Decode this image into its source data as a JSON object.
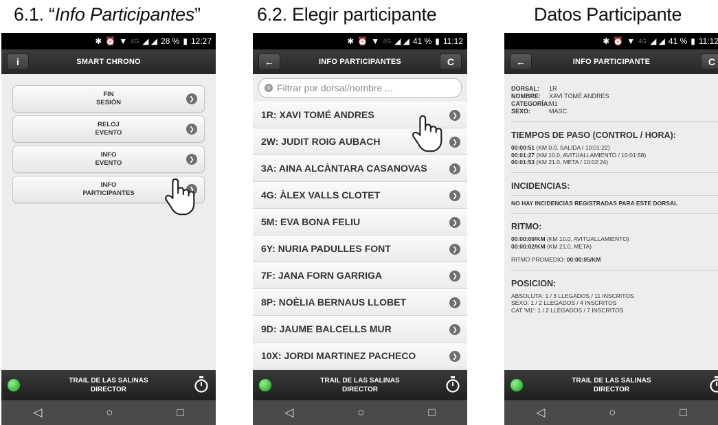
{
  "captions": {
    "c1_prefix": "6.1. “",
    "c1_title": "Info Participantes",
    "c1_suffix": "”",
    "c2": "6.2. Elegir participante",
    "c3": "Datos Participante"
  },
  "phone1": {
    "status": {
      "bt": "✱",
      "alarm": "⏰",
      "wifi": "▼",
      "net": "4G",
      "signal": "◢ ◢",
      "battery_pct": "28 %",
      "battery": "▮",
      "time": "12:27"
    },
    "title": "SMART CHRONO",
    "info_btn": "i",
    "menu": [
      {
        "label": "FIN\nSESIÓN"
      },
      {
        "label": "RELOJ\nEVENTO"
      },
      {
        "label": "INFO\nEVENTO"
      },
      {
        "label": "INFO\nPARTICIPANTES"
      }
    ]
  },
  "phone2": {
    "status": {
      "bt": "✱",
      "alarm": "⏰",
      "wifi": "▼",
      "net": "4G",
      "signal": "◢ ◢",
      "battery_pct": "41 %",
      "battery": "▮",
      "time": "11:12"
    },
    "title": "INFO PARTICIPANTES",
    "back_btn": "←",
    "refresh_btn": "C",
    "filter_placeholder": "Filtrar por dorsal/nombre ...",
    "participants": [
      "1R: XAVI TOMÉ ANDRES",
      "2W: JUDIT ROIG AUBACH",
      "3A: AINA ALCÀNTARA CASANOVAS",
      "4G: ÀLEX VALLS CLOTET",
      "5M: EVA BONA FELIU",
      "6Y: NURIA PADULLES FONT",
      "7F: JANA FORN GARRIGA",
      "8P: NOÈLIA BERNAUS LLOBET",
      "9D: JAUME BALCELLS MUR",
      "10X: JORDI MARTINEZ PACHECO"
    ]
  },
  "phone3": {
    "status": {
      "bt": "✱",
      "alarm": "⏰",
      "wifi": "▼",
      "net": "4G",
      "signal": "◢ ◢",
      "battery_pct": "41 %",
      "battery": "▮",
      "time": "11:12"
    },
    "title": "INFO PARTICIPANTE",
    "back_btn": "←",
    "refresh_btn": "C",
    "fields": {
      "dorsal_k": "DORSAL:",
      "dorsal_v": "1R",
      "nombre_k": "NOMBRE:",
      "nombre_v": "XAVI TOMÉ ANDRES",
      "categoria_k": "CATEGORÍA:",
      "categoria_v": "M1",
      "sexo_k": "SEXO:",
      "sexo_v": "MASC"
    },
    "tiempos_title": "TIEMPOS DE PASO (CONTROL / HORA):",
    "tiempos": [
      {
        "t": "00:00:51",
        "d": " (KM 0.0, SALIDA / 10:01:22)"
      },
      {
        "t": "00:01:27",
        "d": " (KM 10.0, AVITUALLAMIENTO / 10:01:58)"
      },
      {
        "t": "00:01:53",
        "d": " (KM 21.0, META / 10:02:24)"
      }
    ],
    "incidencias_title": "INCIDENCIAS:",
    "incidencias_text": "NO HAY INCIDENCIAS REGISTRADAS PARA ESTE DORSAL",
    "ritmo_title": "RITMO:",
    "ritmos": [
      {
        "t": "00:00:09/KM",
        "d": " (KM 10.0, AVITUALLAMIENTO)"
      },
      {
        "t": "00:00:02/KM",
        "d": " (KM 21.0, META)"
      }
    ],
    "ritmo_prom_label": "RITMO PROMEDIO: ",
    "ritmo_prom_value": "00:00:05/KM",
    "posicion_title": "POSICION:",
    "posicion": [
      "ABSOLUTA: 1 / 3 LLEGADOS / 11 INSCRITOS",
      "SEXO: 1 / 2 LLEGADOS / 4 INSCRITOS",
      "CAT 'M1': 1 / 2 LLEGADOS / 7 INSCRITOS"
    ]
  },
  "footer": {
    "text": "TRAIL DE LAS SALINAS\nDIRECTOR"
  },
  "navbar": {
    "back": "◁",
    "home": "○",
    "recent": "□"
  },
  "colors": {
    "status_green": "#2fbf2f",
    "appbar": "#2e2e2e",
    "background": "#ededed"
  }
}
